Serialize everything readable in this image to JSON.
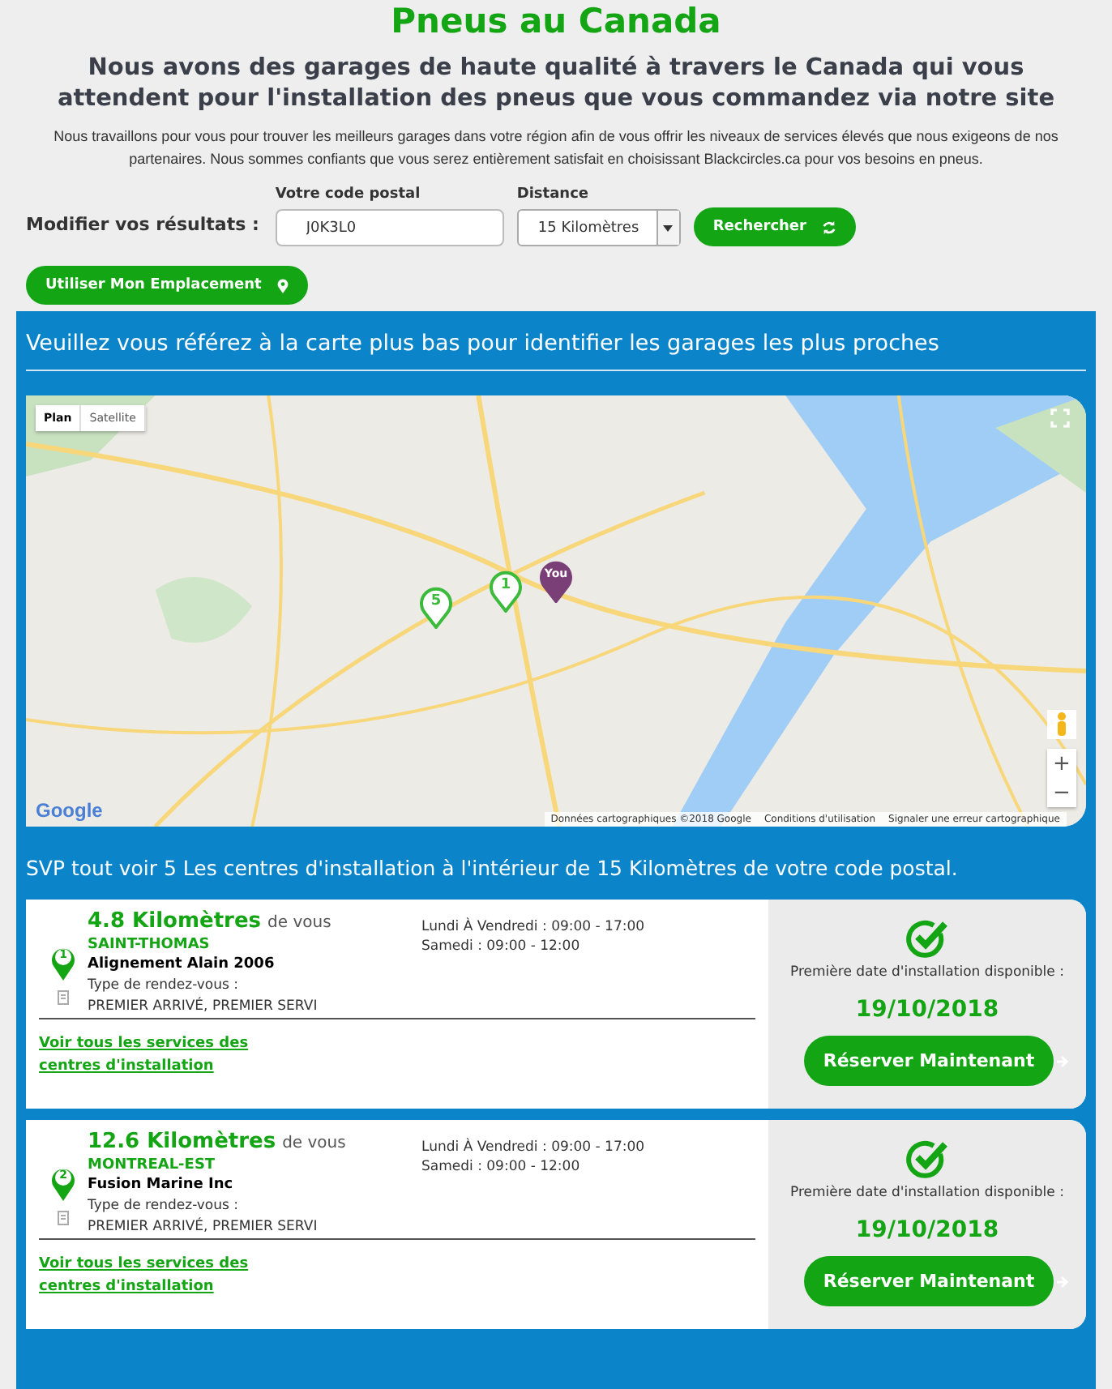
{
  "title": "Pneus au Canada",
  "headline": "Nous avons des garages de haute qualité à travers le Canada qui vous attendent pour l'installation des pneus que vous commandez via notre site",
  "intro": "Nous travaillons pour vous pour trouver les meilleurs garages dans votre région afin de vous offrir les niveaux de services élevés que nous exigeons de nos partenaires. Nous sommes confiants que vous serez entièrement satisfait en choisissant Blackcircles.ca pour vos besoins en pneus.",
  "search": {
    "label": "Modifier vos résultats :",
    "postal_label": "Votre code postal",
    "postal_value": "J0K3L0",
    "distance_label": "Distance",
    "distance_value": "15 Kilomètres",
    "search_button": "Rechercher",
    "location_button": "Utiliser Mon Emplacement"
  },
  "map_heading": "Veuillez vous référez à la carte plus bas pour identifier les garages les plus proches",
  "map": {
    "types": [
      {
        "label": "Plan",
        "selected": true
      },
      {
        "label": "Satellite",
        "selected": false
      }
    ],
    "markers": [
      {
        "label": "5",
        "kind": "garage"
      },
      {
        "label": "1",
        "kind": "garage"
      },
      {
        "label": "You",
        "kind": "user"
      }
    ],
    "zoom_in": "+",
    "zoom_out": "−",
    "logo": "Google",
    "attribution": [
      "Données cartographiques ©2018 Google",
      "Conditions d'utilisation",
      "Signaler une erreur cartographique"
    ]
  },
  "results_heading": "SVP tout voir 5 Les centres d'installation à l'intérieur de 15 Kilomètres de votre code postal.",
  "garages": [
    {
      "number": "1",
      "distance": "4.8 Kilomètres",
      "distance_suffix": "de vous",
      "city": "SAINT-THOMAS",
      "name": "Alignement Alain 2006",
      "hours": [
        "Lundi À Vendredi : 09:00 - 17:00",
        "Samedi : 09:00 - 12:00"
      ],
      "appointment_label": "Type de rendez-vous :",
      "appointment_value": "PREMIER ARRIVÉ, PREMIER SERVI",
      "services_link": "Voir tous les services des centres d'installation",
      "date_label": "Première date d'installation disponible :",
      "date": "19/10/2018",
      "book_button": "Réserver Maintenant"
    },
    {
      "number": "2",
      "distance": "12.6 Kilomètres",
      "distance_suffix": "de vous",
      "city": "MONTREAL-EST",
      "name": "Fusion Marine Inc",
      "hours": [
        "Lundi À Vendredi : 09:00 - 17:00",
        "Samedi : 09:00 - 12:00"
      ],
      "appointment_label": "Type de rendez-vous :",
      "appointment_value": "PREMIER ARRIVÉ, PREMIER SERVI",
      "services_link": "Voir tous les services des centres d'installation",
      "date_label": "Première date d'installation disponible :",
      "date": "19/10/2018",
      "book_button": "Réserver Maintenant"
    }
  ]
}
